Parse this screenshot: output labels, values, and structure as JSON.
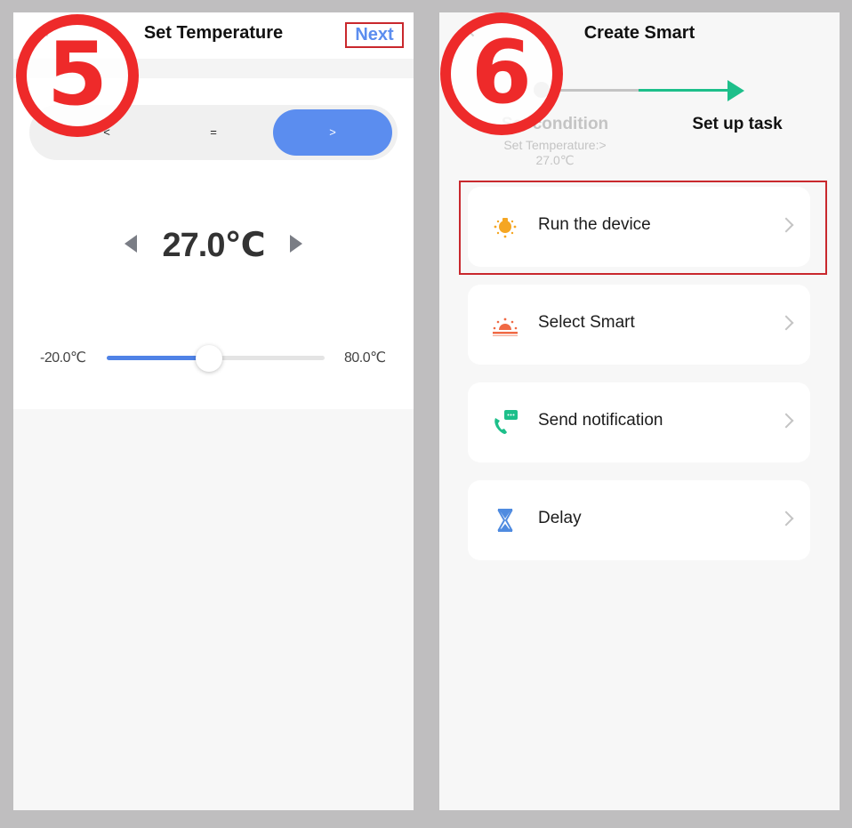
{
  "screen5": {
    "title": "Set Temperature",
    "back_icon": "chevron-left-icon",
    "next_label": "Next",
    "step_badge": "5",
    "comparator": {
      "options": [
        "<",
        "=",
        ">"
      ],
      "selected": ">"
    },
    "temperature": {
      "value_label": "27.0℃",
      "decrease_icon": "triangle-left-icon",
      "increase_icon": "triangle-right-icon"
    },
    "slider": {
      "min_label": "-20.0℃",
      "max_label": "80.0℃",
      "min": -20,
      "max": 80,
      "value": 27
    },
    "colors": {
      "accent": "#5b8def",
      "highlight": "#c9282d"
    }
  },
  "screen6": {
    "title": "Create Smart",
    "back_icon": "chevron-left-icon",
    "step_badge": "6",
    "steps": [
      {
        "label": "Set condition",
        "sublabel": "Set Temperature:>\n27.0℃",
        "state": "done"
      },
      {
        "label": "Set up task",
        "state": "current"
      }
    ],
    "tasks": [
      {
        "label": "Run the device",
        "icon": "bulb-icon",
        "color": "#f5a623",
        "highlighted": true
      },
      {
        "label": "Select Smart",
        "icon": "sunrise-icon",
        "color": "#f06a45",
        "highlighted": false
      },
      {
        "label": "Send notification",
        "icon": "phone-message-icon",
        "color": "#1dbf8a",
        "highlighted": false
      },
      {
        "label": "Delay",
        "icon": "hourglass-icon",
        "color": "#4f8be0",
        "highlighted": false
      }
    ],
    "colors": {
      "progress": "#1dbf8a",
      "inactive": "#c4c4c4"
    }
  }
}
